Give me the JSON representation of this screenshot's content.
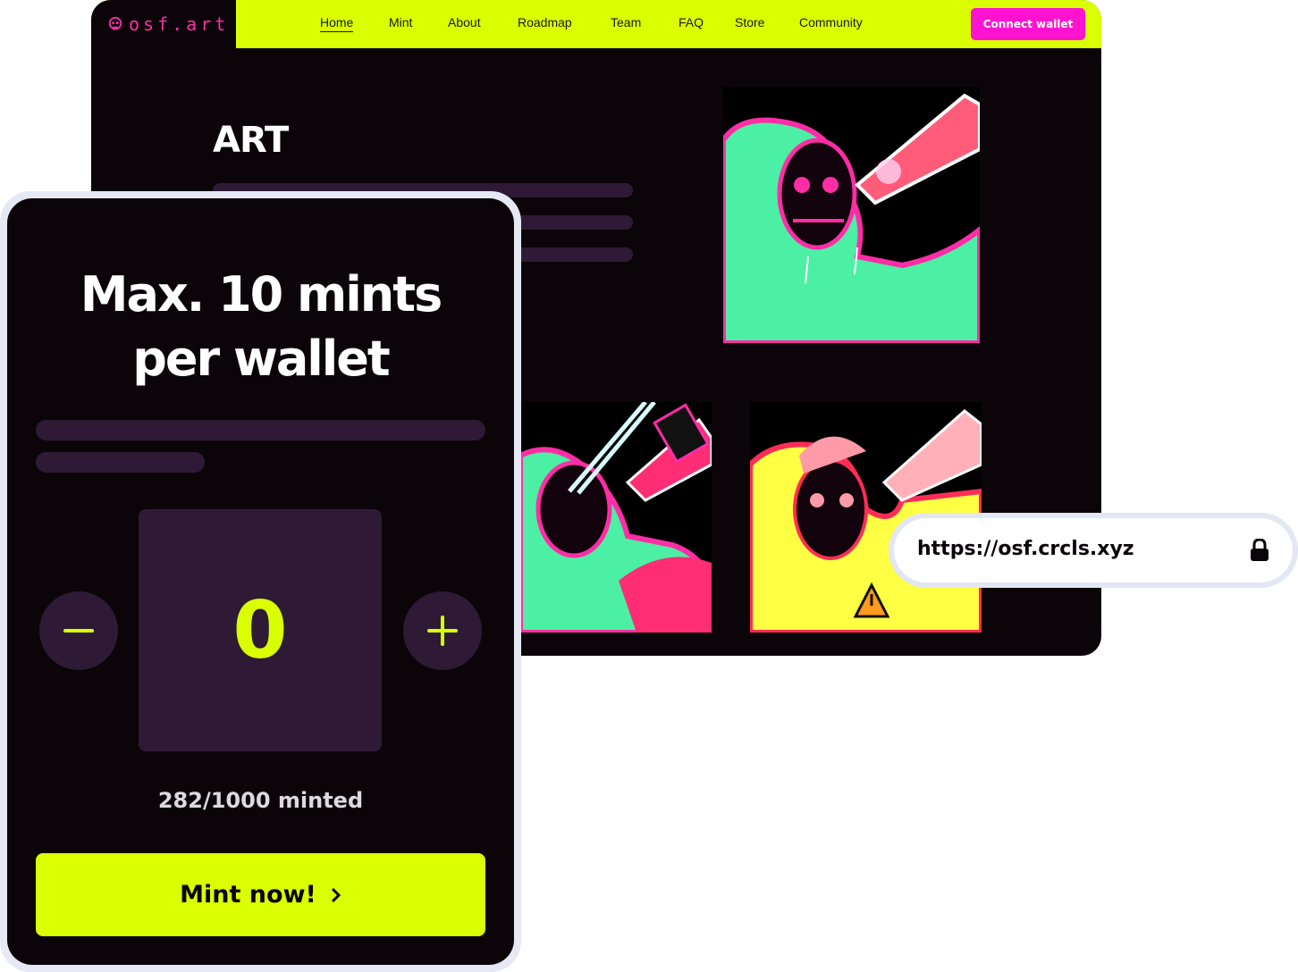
{
  "site": {
    "logo": "osf.art",
    "nav": [
      "Home",
      "Mint",
      "About",
      "Roadmap",
      "Team",
      "FAQ",
      "Store",
      "Community"
    ],
    "active_nav": "Home",
    "connect_label": "Connect wallet",
    "section_title": "ART",
    "gallery": [
      "artwork-1",
      "artwork-2",
      "artwork-3"
    ]
  },
  "url_bar": {
    "url": "https://osf.crcls.xyz",
    "icon": "lock-icon"
  },
  "mint_panel": {
    "title": "Max. 10 mints per wallet",
    "count": "0",
    "minted": "282/1000 minted",
    "mint_label": "Mint now!",
    "icons": [
      "minus-icon",
      "plus-icon",
      "chevron-right-icon"
    ]
  },
  "colors": {
    "accent": "#d9ff00",
    "pink": "#ff13d0",
    "dark": "#0b0509",
    "muted": "#2e1a35"
  }
}
